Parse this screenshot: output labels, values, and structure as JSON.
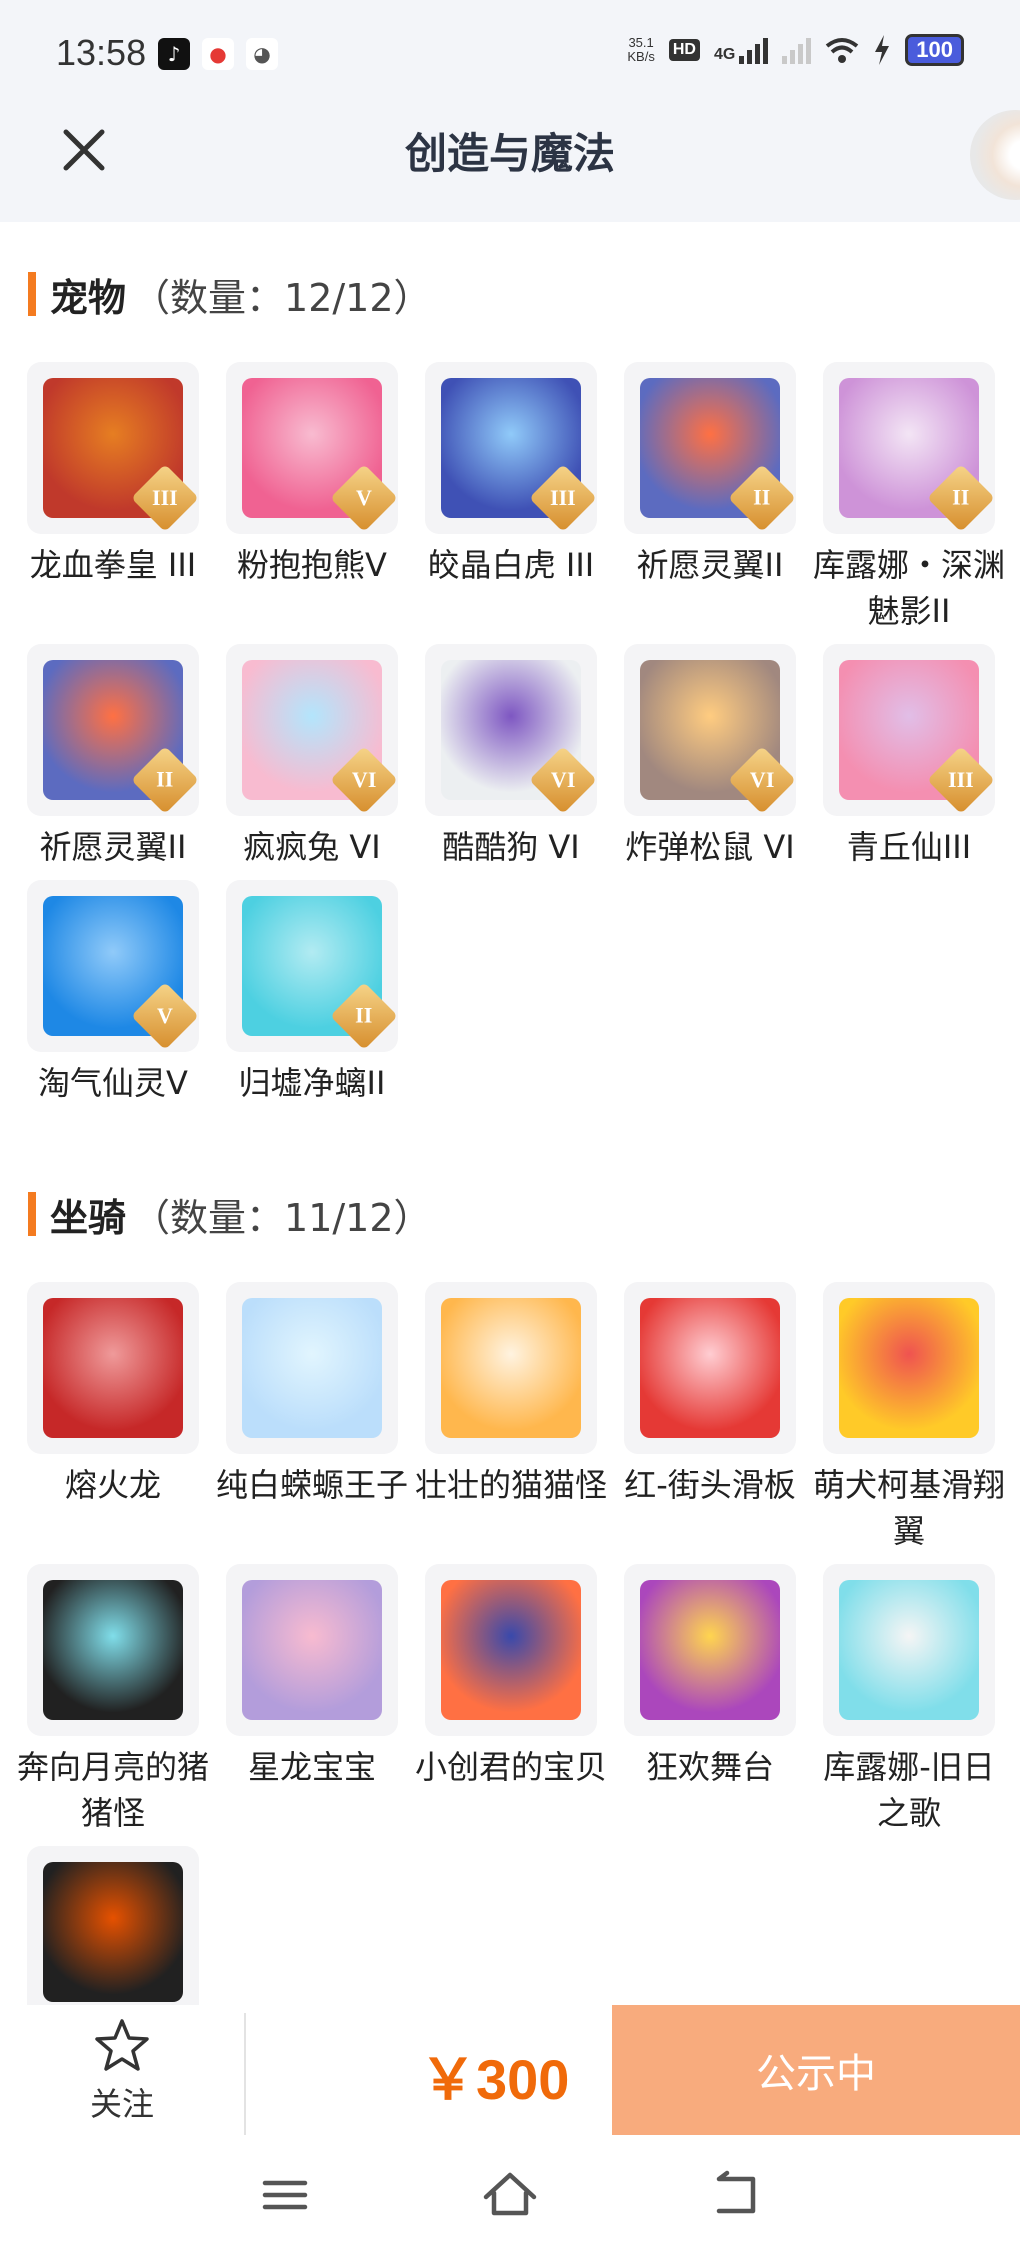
{
  "status_bar": {
    "time": "13:58",
    "speed_top": "35.1",
    "speed_bottom": "KB/s",
    "hd": "HD",
    "network": "4G",
    "battery": "100"
  },
  "header": {
    "title": "创造与魔法"
  },
  "pets": {
    "title": "宠物",
    "count": "（数量：12/12）",
    "items": [
      {
        "label": "龙血拳皇 III",
        "tier": "III",
        "colors": [
          "#c0392b",
          "#e67e22"
        ]
      },
      {
        "label": "粉抱抱熊Ⅴ",
        "tier": "V",
        "colors": [
          "#f06292",
          "#f8bbd0"
        ]
      },
      {
        "label": "皎晶白虎 III",
        "tier": "III",
        "colors": [
          "#3f51b5",
          "#90caf9"
        ]
      },
      {
        "label": "祈愿灵翼II",
        "tier": "II",
        "colors": [
          "#5c6bc0",
          "#ff7043"
        ]
      },
      {
        "label": "库露娜・深渊魅影II",
        "tier": "II",
        "colors": [
          "#ce93d8",
          "#f3e5f5"
        ]
      },
      {
        "label": "祈愿灵翼II",
        "tier": "II",
        "colors": [
          "#5c6bc0",
          "#ff7043"
        ]
      },
      {
        "label": "疯疯兔 VI",
        "tier": "VI",
        "colors": [
          "#f8bbd0",
          "#b3e5fc"
        ]
      },
      {
        "label": "酷酷狗 VI",
        "tier": "VI",
        "colors": [
          "#eceff1",
          "#7e57c2"
        ]
      },
      {
        "label": "炸弹松鼠 VI",
        "tier": "VI",
        "colors": [
          "#a1887f",
          "#ffcc80"
        ]
      },
      {
        "label": "青丘仙III",
        "tier": "III",
        "colors": [
          "#f48fb1",
          "#e1bee7"
        ]
      },
      {
        "label": "淘气仙灵V",
        "tier": "V",
        "colors": [
          "#1e88e5",
          "#90caf9"
        ]
      },
      {
        "label": "归墟净螭II",
        "tier": "II",
        "colors": [
          "#4dd0e1",
          "#b2ebf2"
        ]
      }
    ]
  },
  "mounts": {
    "title": "坐骑",
    "count": "（数量：11/12）",
    "items": [
      {
        "label": "熔火龙",
        "colors": [
          "#c62828",
          "#ef9a9a"
        ]
      },
      {
        "label": "纯白蝾螈王子",
        "colors": [
          "#bbdefb",
          "#e1f5fe"
        ]
      },
      {
        "label": "壮壮的猫猫怪",
        "colors": [
          "#ffb74d",
          "#fff3e0"
        ]
      },
      {
        "label": "红-街头滑板",
        "colors": [
          "#e53935",
          "#ffcdd2"
        ]
      },
      {
        "label": "萌犬柯基滑翔翼",
        "colors": [
          "#ffca28",
          "#ef5350"
        ]
      },
      {
        "label": "奔向月亮的猪猪怪",
        "colors": [
          "#212121",
          "#80deea"
        ]
      },
      {
        "label": "星龙宝宝",
        "colors": [
          "#b39ddb",
          "#f8bbd0"
        ]
      },
      {
        "label": "小创君的宝贝",
        "colors": [
          "#ff7043",
          "#3949ab"
        ]
      },
      {
        "label": "狂欢舞台",
        "colors": [
          "#ab47bc",
          "#ffd54f"
        ]
      },
      {
        "label": "库露娜-旧日之歌",
        "colors": [
          "#80deea",
          "#f5f5f5"
        ]
      },
      {
        "label": "",
        "colors": [
          "#212121",
          "#e65100"
        ]
      }
    ]
  },
  "action_bar": {
    "follow_label": "关注",
    "price": "￥300",
    "status_button": "公示中"
  },
  "colors": {
    "accent": "#f47b20",
    "price": "#f06a0a",
    "button": "#f8ab7d"
  },
  "icons": {
    "close": "close-icon",
    "star": "star-icon",
    "menu": "menu-icon",
    "home": "home-icon",
    "back": "back-icon"
  }
}
